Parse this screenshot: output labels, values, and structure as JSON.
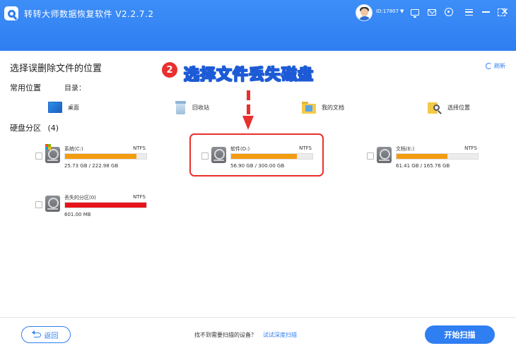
{
  "window": {
    "title": "转转大师数据恢复软件 V2.2.7.2",
    "user_id": "ID:17807",
    "user_caret": "▼",
    "close_glyph": "✕",
    "icons": [
      "app-logo-icon",
      "avatar",
      "monitor-icon",
      "mail-icon",
      "ring-icon",
      "menu-icon",
      "minimize-icon",
      "maximize-icon",
      "close-icon"
    ]
  },
  "colors": {
    "titlebar": "#2f7ef2",
    "accent": "#2f7ef2",
    "usage_bar": "#f39c12",
    "lost_bar": "#e8141b",
    "annotation": "#e8302e"
  },
  "main": {
    "section_title": "选择误删除文件的位置",
    "refresh_label": "刷新",
    "common_locations_label": "常用位置",
    "directory_label": "目录：",
    "locations": [
      {
        "label": "桌面",
        "icon": "desktop-icon"
      },
      {
        "label": "回收站",
        "icon": "recycle-bin-icon"
      },
      {
        "label": "我的文档",
        "icon": "documents-folder-icon"
      },
      {
        "label": "选择位置",
        "icon": "choose-location-icon"
      }
    ],
    "disk_partitions_label": "硬盘分区",
    "disk_partitions_count": "(4)",
    "drives": [
      {
        "name": "系统(C:)",
        "fs": "NTFS",
        "size": "25.73 GB / 222.98 GB",
        "usage_fraction": 0.88,
        "bar_color": "#f39c12"
      },
      {
        "name": "软件(D:)",
        "fs": "NTFS",
        "size": "56.90 GB / 300.00 GB",
        "usage_fraction": 0.81,
        "bar_color": "#f39c12"
      },
      {
        "name": "文档(E:)",
        "fs": "NTFS",
        "size": "61.41 GB / 165.76 GB",
        "usage_fraction": 0.63,
        "bar_color": "#f39c12"
      },
      {
        "name": "丢失的分区(0)",
        "fs": "NTFS",
        "size": "601.00 MB",
        "usage_fraction": 1.0,
        "bar_color": "#e8141b"
      }
    ]
  },
  "annotation": {
    "step_number": "2",
    "text": "选择文件丢失磁盘"
  },
  "footer": {
    "back_label": "返回",
    "hint_text": "找不到需要扫描的设备？",
    "deep_scan_link": "试试深度扫描",
    "start_scan_label": "开始扫描"
  }
}
